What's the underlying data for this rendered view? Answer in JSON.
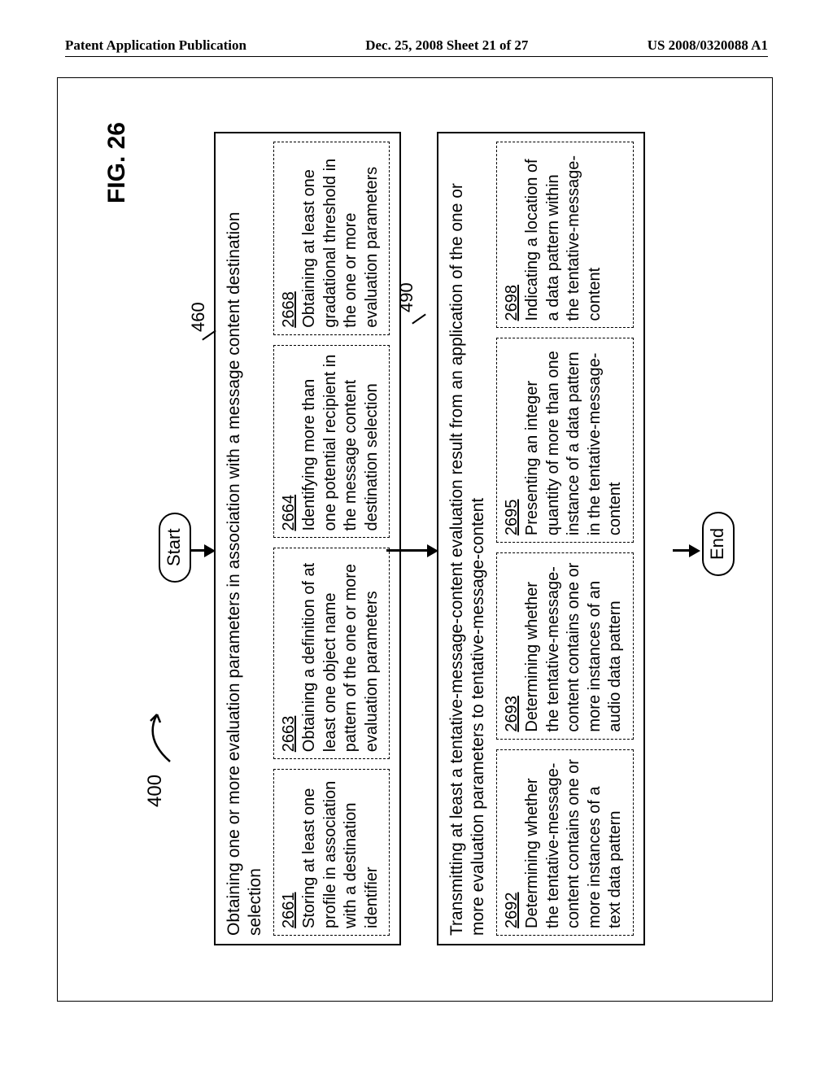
{
  "header": {
    "left": "Patent Application Publication",
    "center": "Dec. 25, 2008  Sheet 21 of 27",
    "right": "US 2008/0320088 A1"
  },
  "fig": {
    "label": "FIG. 26",
    "ref400": "400",
    "start": "Start",
    "end": "End",
    "tag460": "460",
    "tag490": "490",
    "block460": {
      "title": "Obtaining one or more evaluation parameters in association with a message content destination selection",
      "subs": {
        "2661": {
          "id": "2661",
          "text": "Storing at least one profile in association with a destination identifier"
        },
        "2663": {
          "id": "2663",
          "text": "Obtaining a definition of at least one object name pattern of the one or more evaluation parameters"
        },
        "2664": {
          "id": "2664",
          "text": "Identifying more than one potential recipient in the message content destination selection"
        },
        "2668": {
          "id": "2668",
          "text": "Obtaining at least one gradational threshold in the one or more evaluation parameters"
        }
      }
    },
    "block490": {
      "title": "Transmitting at least a tentative-message-content evaluation result from an application of the one or more evaluation parameters to tentative-message-content",
      "subs": {
        "2692": {
          "id": "2692",
          "text": "Determining whether the tentative-message-content contains one or more instances of a text data pattern"
        },
        "2693": {
          "id": "2693",
          "text": "Determining whether the tentative-message-content contains one or more instances of an audio data pattern"
        },
        "2695": {
          "id": "2695",
          "text": "Presenting an integer quantity of more than one instance of a data pattern in the tentative-message-content"
        },
        "2698": {
          "id": "2698",
          "text": "Indicating a location of a data pattern within the tentative-message-content"
        }
      }
    }
  }
}
